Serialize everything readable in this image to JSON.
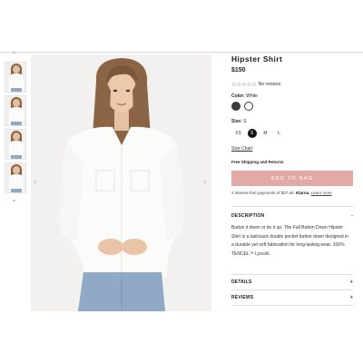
{
  "product": {
    "title": "Hipster Shirt",
    "price": "$150",
    "reviews_text": "No reviews",
    "stars": "☆☆☆☆☆"
  },
  "color": {
    "label": "Color:",
    "selected": "White",
    "swatches": [
      {
        "name": "Black",
        "hex": "#3c3c3c"
      },
      {
        "name": "White",
        "hex": "#ffffff"
      }
    ]
  },
  "size": {
    "label": "Size:",
    "selected": "S",
    "options": [
      "XS",
      "S",
      "M",
      "L"
    ]
  },
  "size_chart_label": "Size Chart",
  "shipping_label": "Free Shipping and Returns",
  "add_to_bag_label": "ADD TO BAG",
  "klarna": {
    "prefix": "4 interest-free payments of $37.50.",
    "brand": "Klarna.",
    "link": "Learn more"
  },
  "accordion": {
    "description": {
      "label": "DESCRIPTION",
      "toggle": "-",
      "text": "Button it down or tie it up. The Full Button Down Hipster Shirt is a laid-back double pocket button down designed in a durable yet soft fabrication for long-lasting wear. 100% TENCEL™ Lyocell."
    },
    "details": {
      "label": "DETAILS",
      "toggle": "+"
    },
    "reviews": {
      "label": "REVIEWS",
      "toggle": "+"
    }
  },
  "gallery": {
    "up_arrow": "⌃",
    "down_arrow": "⌄",
    "prev_arrow": "‹",
    "next_arrow": "›"
  },
  "colors": {
    "accent_button": "#e3a9a4",
    "text": "#222222"
  }
}
